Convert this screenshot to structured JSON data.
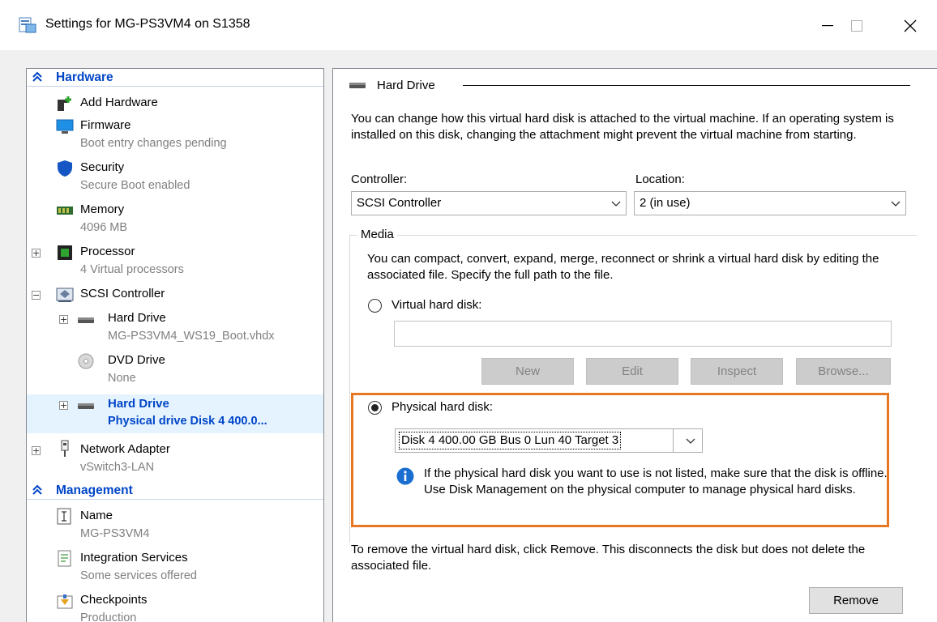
{
  "window": {
    "title": "Settings for MG-PS3VM4 on S1358",
    "minimize_label": "—",
    "close_label": "✕"
  },
  "sidebar": {
    "hardware_header": "Hardware",
    "management_header": "Management",
    "items": [
      {
        "label": "Add Hardware",
        "sub": ""
      },
      {
        "label": "Firmware",
        "sub": "Boot entry changes pending"
      },
      {
        "label": "Security",
        "sub": "Secure Boot enabled"
      },
      {
        "label": "Memory",
        "sub": "4096 MB"
      },
      {
        "label": "Processor",
        "sub": "4 Virtual processors"
      },
      {
        "label": "SCSI Controller",
        "sub": ""
      },
      {
        "label": "Hard Drive",
        "sub": "MG-PS3VM4_WS19_Boot.vhdx"
      },
      {
        "label": "DVD Drive",
        "sub": "None"
      },
      {
        "label": "Hard Drive",
        "sub": "Physical drive Disk 4 400.0..."
      },
      {
        "label": "Network Adapter",
        "sub": "vSwitch3-LAN"
      },
      {
        "label": "Name",
        "sub": "MG-PS3VM4"
      },
      {
        "label": "Integration Services",
        "sub": "Some services offered"
      },
      {
        "label": "Checkpoints",
        "sub": "Production"
      }
    ]
  },
  "main": {
    "group_title": "Hard Drive",
    "intro": "You can change how this virtual hard disk is attached to the virtual machine. If an operating system is installed on this disk, changing the attachment might prevent the virtual machine from starting.",
    "controller_label": "Controller:",
    "controller_value": "SCSI Controller",
    "location_label": "Location:",
    "location_value": "2 (in use)",
    "media_label": "Media",
    "media_desc": "You can compact, convert, expand, merge, reconnect or shrink a virtual hard disk by editing the associated file. Specify the full path to the file.",
    "vhd_radio_label": "Virtual hard disk:",
    "vhd_path_value": "",
    "buttons": {
      "new": "New",
      "edit": "Edit",
      "inspect": "Inspect",
      "browse": "Browse..."
    },
    "physical_radio_label": "Physical hard disk:",
    "physical_disk_value": "Disk 4 400.00 GB Bus 0 Lun 40 Target 3",
    "info_text": "If the physical hard disk you want to use is not listed, make sure that the disk is offline. Use Disk Management on the physical computer to manage physical hard disks.",
    "remove_text": "To remove the virtual hard disk, click Remove. This disconnects the disk but does not delete the associated file.",
    "remove_button": "Remove"
  },
  "colors": {
    "accent": "#0046c8",
    "highlight": "#e87722",
    "selected_bg": "#e5f3ff"
  }
}
